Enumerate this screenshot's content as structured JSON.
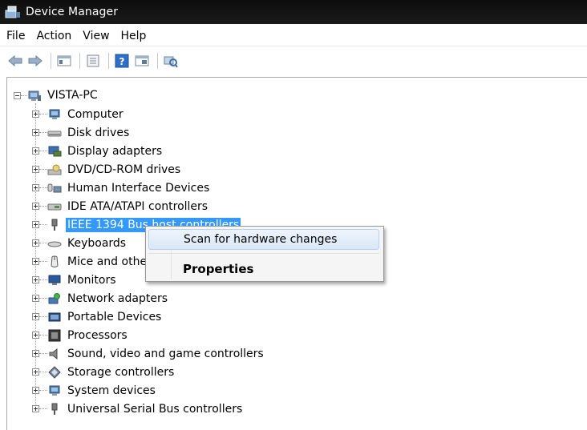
{
  "window": {
    "title": "Device Manager"
  },
  "menu": [
    "File",
    "Action",
    "View",
    "Help"
  ],
  "toolbar": {
    "buttons": [
      "back-arrow-icon",
      "forward-arrow-icon",
      "console-tree-icon",
      "properties-icon",
      "help-icon",
      "view-icon",
      "scan-hardware-icon"
    ]
  },
  "tree": {
    "root": "VISTA-PC",
    "items": [
      {
        "label": "Computer",
        "icon": "computer-icon"
      },
      {
        "label": "Disk drives",
        "icon": "disk-drive-icon"
      },
      {
        "label": "Display adapters",
        "icon": "display-adapter-icon"
      },
      {
        "label": "DVD/CD-ROM drives",
        "icon": "dvd-drive-icon"
      },
      {
        "label": "Human Interface Devices",
        "icon": "hid-icon"
      },
      {
        "label": "IDE ATA/ATAPI controllers",
        "icon": "ide-controller-icon"
      },
      {
        "label": "IEEE 1394 Bus host controllers",
        "icon": "firewire-icon",
        "selected": true
      },
      {
        "label": "Keyboards",
        "icon": "keyboard-icon"
      },
      {
        "label": "Mice and other pointing devices",
        "icon": "mouse-icon"
      },
      {
        "label": "Monitors",
        "icon": "monitor-icon"
      },
      {
        "label": "Network adapters",
        "icon": "network-adapter-icon"
      },
      {
        "label": "Portable Devices",
        "icon": "portable-device-icon"
      },
      {
        "label": "Processors",
        "icon": "processor-icon"
      },
      {
        "label": "Sound, video and game controllers",
        "icon": "sound-icon"
      },
      {
        "label": "Storage controllers",
        "icon": "storage-controller-icon"
      },
      {
        "label": "System devices",
        "icon": "system-device-icon"
      },
      {
        "label": "Universal Serial Bus controllers",
        "icon": "usb-icon"
      }
    ]
  },
  "context_menu": {
    "scan": "Scan for hardware changes",
    "properties": "Properties"
  },
  "colors": {
    "selection": "#3399ff",
    "titlebar": "#111111"
  }
}
